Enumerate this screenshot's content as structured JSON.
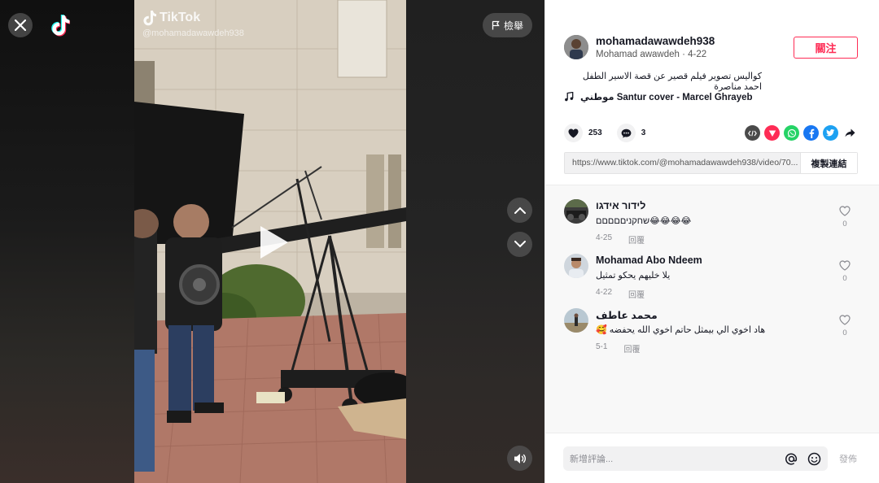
{
  "video": {
    "report_label": "檢舉",
    "watermark_brand": "TikTok",
    "watermark_handle": "@mohamadawawdeh938"
  },
  "author": {
    "username": "mohamadawawdeh938",
    "display_name": "Mohamad awawdeh",
    "date": "4-22",
    "follow_label": "關注"
  },
  "caption": "كواليس تصوير فيلم قصير عن قصة الاسير الطفل احمد مناصرة",
  "music": "موطني Santur cover - Marcel Ghrayeb",
  "stats": {
    "likes": "253",
    "comments": "3"
  },
  "share": {
    "link": "https://www.tiktok.com/@mohamadawawdeh938/video/70...",
    "copy_label": "複製連結"
  },
  "comments": [
    {
      "name": "לידור אידגו",
      "text": "שחקניםםםםם😂😂😂😂",
      "date": "4-25",
      "reply": "回覆",
      "likes": "0"
    },
    {
      "name": "Mohamad Abo Ndeem",
      "text": "يلا خليهم يحكو تمثيل",
      "date": "4-22",
      "reply": "回覆",
      "likes": "0"
    },
    {
      "name": "محمد عاطف",
      "text": "🥰 هاد اخوي الي بيمثل حاتم اخوي الله يحفضه",
      "date": "5-1",
      "reply": "回覆",
      "likes": "0"
    }
  ],
  "composer": {
    "placeholder": "新增評論...",
    "post_label": "發佈"
  },
  "colors": {
    "brand_red": "#fe2c55",
    "whatsapp": "#25d366",
    "facebook": "#1877f2",
    "twitter": "#1da1f2",
    "embed": "#4a4a4a",
    "tiktok_send": "#fe2c55"
  }
}
